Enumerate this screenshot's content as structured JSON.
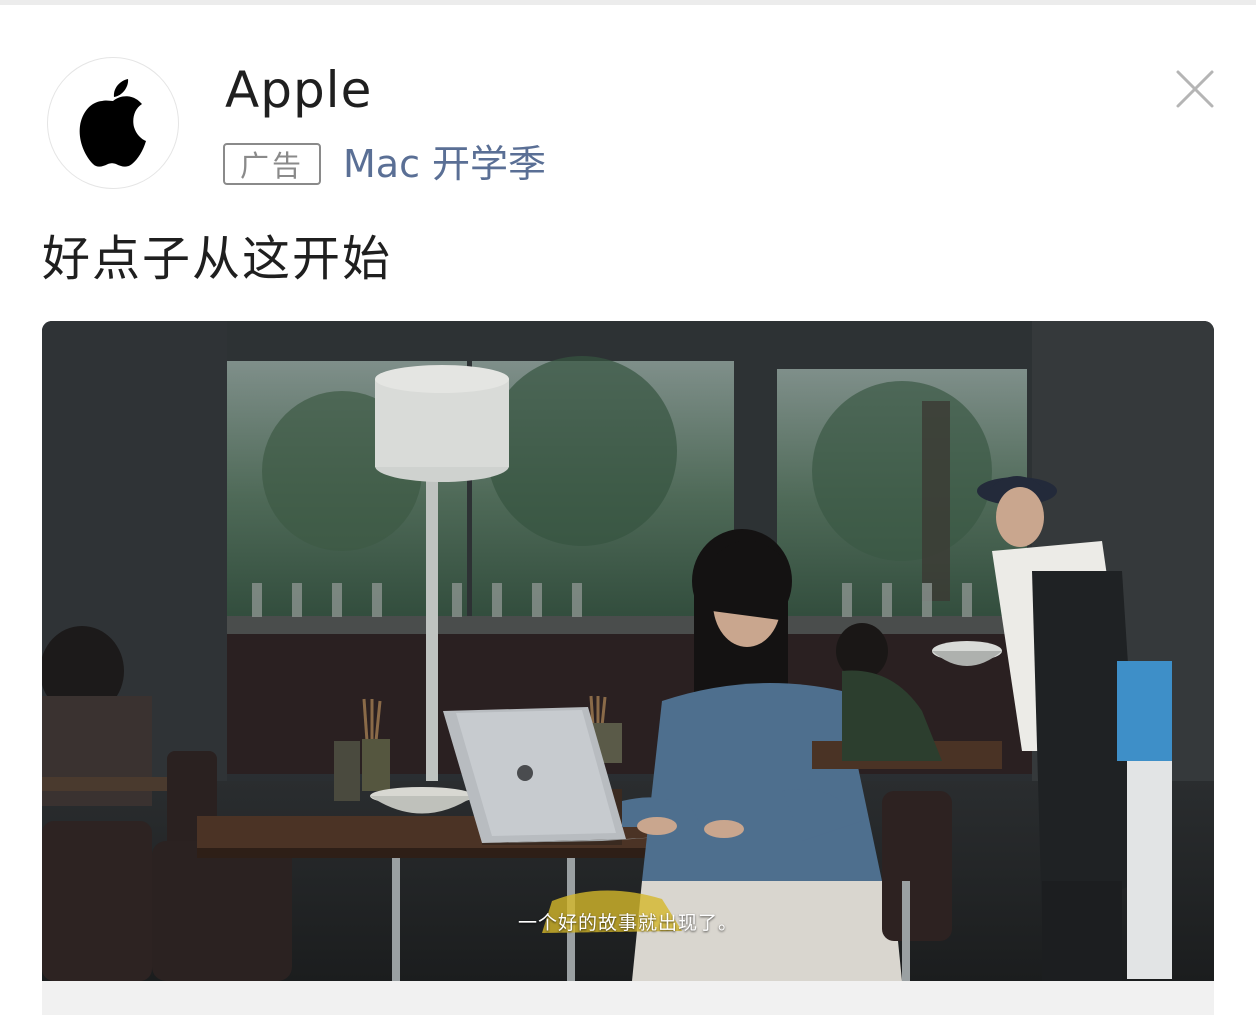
{
  "ad": {
    "brand_name": "Apple",
    "badge_label": "广告",
    "campaign": "Mac 开学季",
    "headline": "好点子从这开始",
    "logo_icon": "apple-logo-icon",
    "close_icon": "close-icon"
  },
  "video": {
    "subtitle": "一个好的故事就出现了。"
  },
  "colors": {
    "campaign_link": "#5a6f95",
    "badge_border": "#8a8a8a",
    "text_primary": "#1f1f1f"
  }
}
